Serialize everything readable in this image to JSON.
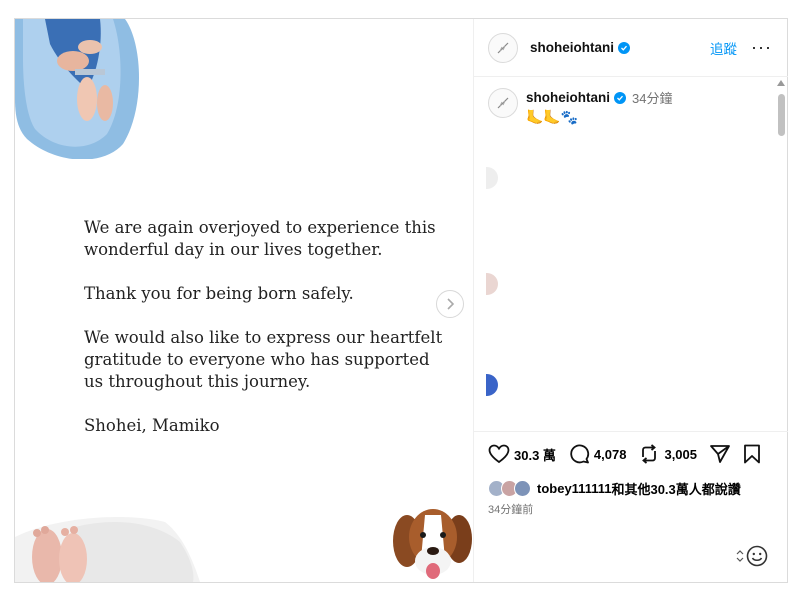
{
  "post": {
    "letter": {
      "p1": "We are again overjoyed to experience this wonderful day in our lives together.",
      "p2": "Thank you for being born safely.",
      "p3": "We would also like to express our heartfelt gratitude to everyone who has supported us throughout this journey.",
      "p4": "Shohei, Mamiko"
    }
  },
  "header": {
    "username": "shoheiohtani",
    "follow_label": "追蹤",
    "more_label": "···"
  },
  "caption": {
    "username": "shoheiohtani",
    "time": "34分鐘",
    "emojis": "🦶🦶🐾"
  },
  "actions": {
    "likes_count": "30.3 萬",
    "comments_count": "4,078",
    "reposts_count": "3,005"
  },
  "likes_summary": {
    "text_user": "tobey111111",
    "text_rest": "和其他30.3萬人都說讚"
  },
  "posted_time": "34分鐘前",
  "colors": {
    "accent": "#0095f6",
    "muted": "#737373",
    "border": "#dbdbdb"
  }
}
